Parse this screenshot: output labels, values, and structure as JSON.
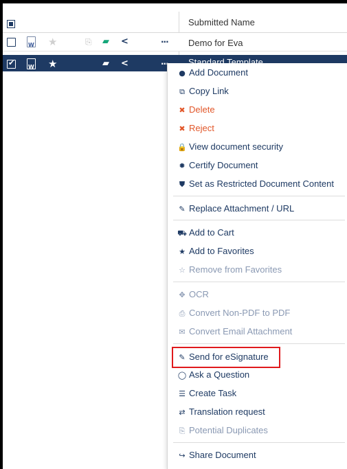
{
  "grid": {
    "column_title": "Submitted Name",
    "rows": [
      {
        "name": "Demo for Eva",
        "selected": false,
        "favorite": false
      },
      {
        "name": "Standard Template",
        "selected": true,
        "favorite": true
      }
    ]
  },
  "icons": {
    "doc_letter": "W",
    "star": "★",
    "duplicate": "⎘",
    "note": "▰",
    "share": "<",
    "more": "···"
  },
  "menu": {
    "items": [
      {
        "icon": "●",
        "label": "Add Document"
      },
      {
        "icon": "⧉",
        "label": "Copy Link"
      },
      {
        "icon": "✖",
        "label": "Delete"
      },
      {
        "icon": "✖",
        "label": "Reject"
      },
      {
        "icon": "🔒",
        "label": "View document security"
      },
      {
        "icon": "✹",
        "label": "Certify Document"
      },
      {
        "icon": "⛊",
        "label": "Set as Restricted Document Content"
      },
      {
        "icon": "✎",
        "label": "Replace Attachment / URL"
      },
      {
        "icon": "⛟",
        "label": "Add to Cart"
      },
      {
        "icon": "★",
        "label": "Add to Favorites"
      },
      {
        "icon": "☆",
        "label": "Remove from Favorites"
      },
      {
        "icon": "✥",
        "label": "OCR"
      },
      {
        "icon": "⎙",
        "label": "Convert Non-PDF to PDF"
      },
      {
        "icon": "✉",
        "label": "Convert Email Attachment"
      },
      {
        "icon": "✎",
        "label": "Send for eSignature"
      },
      {
        "icon": "◯",
        "label": "Ask a Question"
      },
      {
        "icon": "☰",
        "label": "Create Task"
      },
      {
        "icon": "⇄",
        "label": "Translation request"
      },
      {
        "icon": "⎘",
        "label": "Potential Duplicates"
      },
      {
        "icon": "↪",
        "label": "Share Document"
      }
    ]
  },
  "colors": {
    "navy": "#1e3a63",
    "danger": "#e2572a",
    "disabled": "#8a99b3",
    "highlight": "#e0191c"
  }
}
